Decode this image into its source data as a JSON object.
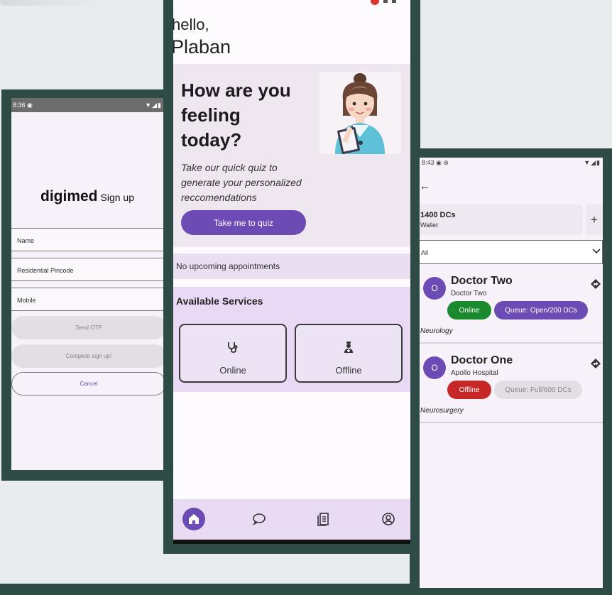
{
  "signup": {
    "status_time": "8:36",
    "brand": "digimed",
    "title": "Sign up",
    "fields": [
      "Name",
      "Residential Pincode",
      "Mobile"
    ],
    "send_otp": "Send OTP",
    "complete": "Complete sign up!",
    "cancel": "Cancel"
  },
  "home": {
    "greeting": "hello,",
    "user_name": "Plaban",
    "hero_title": "How are you feeling today?",
    "hero_desc": "Take our quick quiz to generate your personalized reccomendations",
    "quiz_button": "Take me to quiz",
    "no_appointments": "No upcoming appointments",
    "services_title": "Available Services",
    "services": [
      {
        "label": "Online",
        "icon": "stethoscope-icon"
      },
      {
        "label": "Offline",
        "icon": "doctor-person-icon"
      }
    ],
    "nav": [
      {
        "icon": "home-icon",
        "active": true
      },
      {
        "icon": "chat-icon",
        "active": false
      },
      {
        "icon": "document-icon",
        "active": false
      },
      {
        "icon": "account-icon",
        "active": false
      }
    ],
    "colors": {
      "primary": "#6d4bb4",
      "hero_bg": "#efe7f0",
      "services_bg": "#e9d9f4"
    }
  },
  "doctors": {
    "status_time": "8:43",
    "wallet_amount": "1400 DCs",
    "wallet_label": "Wallet",
    "add_label": "+",
    "filter_value": "All",
    "list": [
      {
        "initial": "O",
        "name": "Doctor Two",
        "subtitle": "Doctor Two",
        "status": "Online",
        "status_color": "#1b8a2e",
        "queue": "Queue: Open/200 DCs",
        "queue_color": "#6d4bb4",
        "specialty": "Neurology"
      },
      {
        "initial": "O",
        "name": "Doctor One",
        "subtitle": "Apollo Hospital",
        "status": "Offline",
        "status_color": "#c62828",
        "queue": "Queue: Full/600 DCs",
        "queue_color": "#e2dee3",
        "specialty": "Neurosurgery"
      }
    ]
  }
}
